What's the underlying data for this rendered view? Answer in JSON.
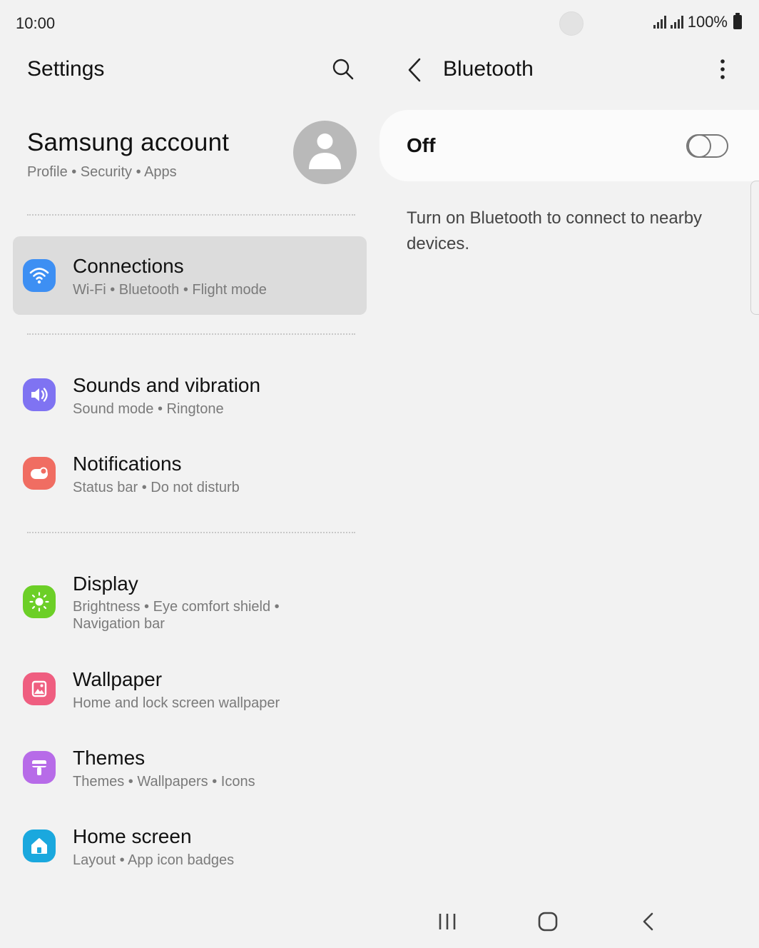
{
  "status_bar": {
    "time": "10:00",
    "battery": "100%"
  },
  "left_pane": {
    "title": "Settings",
    "account": {
      "title": "Samsung account",
      "subtitle": "Profile  •  Security  •  Apps"
    },
    "items": [
      {
        "title": "Connections",
        "subtitle": "Wi-Fi  •  Bluetooth  •  Flight mode",
        "icon": "wifi-icon",
        "color": "#3d8ff3"
      },
      {
        "title": "Sounds and vibration",
        "subtitle": "Sound mode  •  Ringtone",
        "icon": "speaker-icon",
        "color": "#7f73f2"
      },
      {
        "title": "Notifications",
        "subtitle": "Status bar  •  Do not disturb",
        "icon": "notification-icon",
        "color": "#f06d62"
      },
      {
        "title": "Display",
        "subtitle": "Brightness  •  Eye comfort shield  •",
        "subtitle2": "Navigation bar",
        "icon": "sun-icon",
        "color": "#6ccf27"
      },
      {
        "title": "Wallpaper",
        "subtitle": "Home and lock screen wallpaper",
        "icon": "image-icon",
        "color": "#ef5e80"
      },
      {
        "title": "Themes",
        "subtitle": "Themes  •  Wallpapers  •  Icons",
        "icon": "brush-icon",
        "color": "#b76be8"
      },
      {
        "title": "Home screen",
        "subtitle": "Layout  •  App icon badges",
        "icon": "home-icon",
        "color": "#1aa8de"
      }
    ]
  },
  "right_pane": {
    "title": "Bluetooth",
    "toggle_label": "Off",
    "toggle_state": "off",
    "description": "Turn on Bluetooth to connect to nearby devices."
  },
  "nav_bar": {
    "buttons": [
      "recents-icon",
      "home-icon",
      "back-icon"
    ]
  }
}
